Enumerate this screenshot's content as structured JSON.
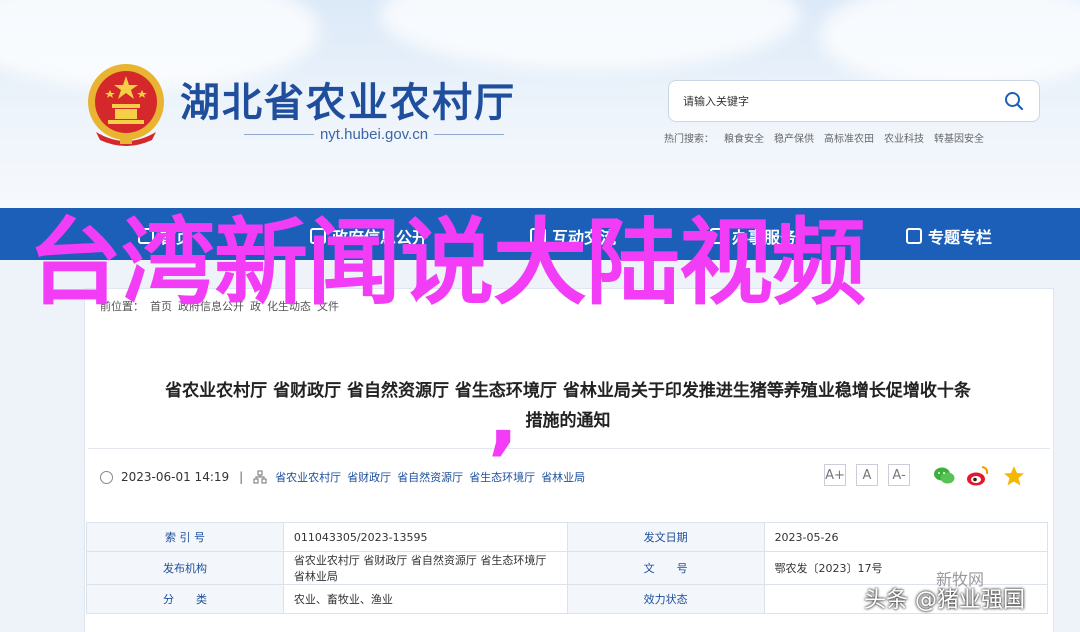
{
  "header": {
    "site_title": "湖北省农业农村厅",
    "site_domain": "nyt.hubei.gov.cn",
    "search": {
      "placeholder": "请输入关键字"
    },
    "hot_search": {
      "label": "热门搜索：",
      "items": [
        "粮食安全",
        "稳产保供",
        "高标准农田",
        "农业科技",
        "转基因安全"
      ]
    }
  },
  "nav": {
    "items": [
      {
        "label": "首页",
        "icon": "home-icon"
      },
      {
        "label": "政府信息公开",
        "icon": "document-icon"
      },
      {
        "label": "互动交流",
        "icon": "chat-icon"
      },
      {
        "label": "办事服务",
        "icon": "bookmark-icon"
      },
      {
        "label": "专题专栏",
        "icon": "folder-icon"
      }
    ]
  },
  "breadcrumb": [
    "前位置：",
    "首页",
    "政府信息公开",
    "政",
    "化生动态",
    "文件"
  ],
  "article": {
    "title_line1": "省农业农村厅 省财政厅 省自然资源厅 省生态环境厅 省林业局关于印发推进生猪等养殖业稳增长促增收十条",
    "title_line2": "措施的通知",
    "date": "2023-06-01 14:19",
    "sep": "|",
    "sources": [
      "省农业农村厅",
      "省财政厅",
      "省自然资源厅",
      "省生态环境厅",
      "省林业局"
    ]
  },
  "font_controls": [
    "A+",
    "A",
    "A-"
  ],
  "share_icons": [
    "wechat-icon",
    "weibo-icon",
    "favorite-icon"
  ],
  "info_table": [
    {
      "k1": "索 引 号",
      "v1": "011043305/2023-13595",
      "k2": "发文日期",
      "v2": "2023-05-26"
    },
    {
      "k1": "发布机构",
      "v1": "省农业农村厅 省财政厅 省自然资源厅 省生态环境厅 省林业局",
      "k2": "文　　号",
      "v2": "鄂农发〔2023〕17号"
    },
    {
      "k1": "分　　类",
      "v1": "农业、畜牧业、渔业",
      "k2": "效力状态",
      "v2": ""
    }
  ],
  "overlay": {
    "headline": "台湾新闻说大陆视频",
    "comma": ",",
    "watermark": "头条 @猪业强国",
    "watermark2": "新牧网"
  },
  "colors": {
    "nav_blue": "#1c5fb8",
    "title_blue": "#1f4f9c",
    "overlay_magenta": "#f23cf6"
  }
}
